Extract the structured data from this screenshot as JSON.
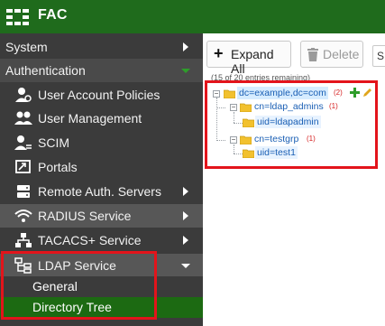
{
  "app": {
    "title": "FAC",
    "logo_icon": "fortinet-grid-icon"
  },
  "colors": {
    "topbar": "#1f6b1c",
    "sidebar": "#3b3b3b",
    "selected": "#1c6a12",
    "highlight": "#e3141b",
    "add_icon": "#2e9d2a",
    "edit_icon": "#e0a51c"
  },
  "sidebar": {
    "sections": [
      {
        "label": "System",
        "expanded": false
      },
      {
        "label": "Authentication",
        "expanded": true
      }
    ],
    "items": [
      {
        "label": "User Account Policies",
        "icon": "user-gear-icon"
      },
      {
        "label": "User Management",
        "icon": "users-icon"
      },
      {
        "label": "SCIM",
        "icon": "user-sync-icon"
      },
      {
        "label": "Portals",
        "icon": "portal-icon"
      },
      {
        "label": "Remote Auth. Servers",
        "icon": "server-icon"
      },
      {
        "label": "RADIUS Service",
        "icon": "wifi-icon"
      },
      {
        "label": "TACACS+ Service",
        "icon": "network-icon"
      },
      {
        "label": "LDAP Service",
        "icon": "sitemap-icon",
        "expanded": true
      }
    ],
    "subitems": [
      {
        "label": "General",
        "selected": false
      },
      {
        "label": "Directory Tree",
        "selected": true
      }
    ]
  },
  "toolbar": {
    "expand_all_label": "Expand All",
    "delete_label": "Delete",
    "search_placeholder": "S",
    "entries_note": "(15 of 20 entries remaining)"
  },
  "tree": {
    "root": {
      "label": "dc=example,dc=com",
      "count": "(2)"
    },
    "groups": [
      {
        "label": "cn=ldap_admins",
        "count": "(1)",
        "children": [
          {
            "label": "uid=ldapadmin"
          }
        ]
      },
      {
        "label": "cn=testgrp",
        "count": "(1)",
        "children": [
          {
            "label": "uid=test1"
          }
        ]
      }
    ]
  }
}
